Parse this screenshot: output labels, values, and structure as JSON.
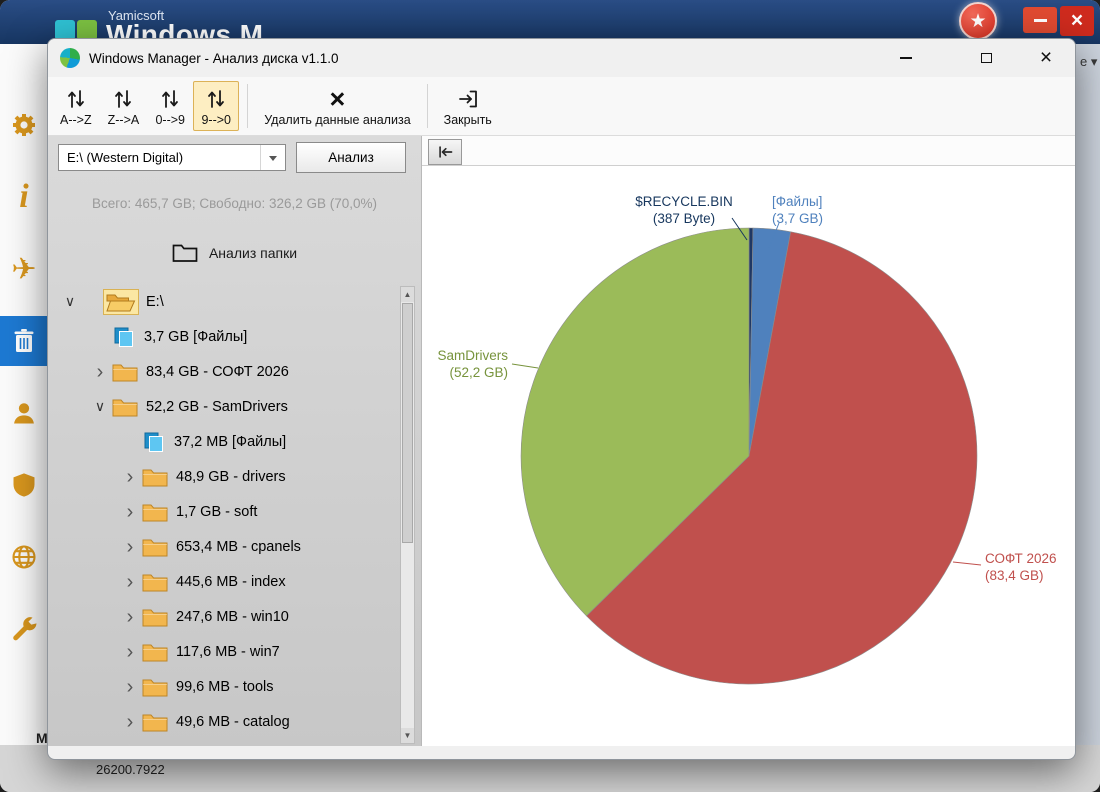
{
  "bg": {
    "brand": "Yamicsoft",
    "app_title": "Windows M",
    "edge_text": "e ▾",
    "fragment": "M",
    "build": "26200.7922",
    "sidebar_icons": [
      {
        "name": "gear",
        "selected": false
      },
      {
        "name": "info",
        "selected": false
      },
      {
        "name": "airplane",
        "selected": false
      },
      {
        "name": "trash",
        "selected": true
      },
      {
        "name": "user",
        "selected": false
      },
      {
        "name": "shield",
        "selected": false
      },
      {
        "name": "globe",
        "selected": false
      },
      {
        "name": "wrench",
        "selected": false
      }
    ]
  },
  "dialog": {
    "title": "Windows Manager - Анализ диска v1.1.0",
    "toolbar": {
      "sort_buttons": [
        {
          "id": "az",
          "label": "A-->Z",
          "selected": false
        },
        {
          "id": "za",
          "label": "Z-->A",
          "selected": false
        },
        {
          "id": "09",
          "label": "0-->9",
          "selected": false
        },
        {
          "id": "90",
          "label": "9-->0",
          "selected": true
        }
      ],
      "delete_label": "Удалить данные анализа",
      "close_label": "Закрыть"
    },
    "drive_combo": {
      "value": "E:\\ (Western Digital)"
    },
    "analyze_button": "Анализ",
    "summary": "Всего: 465,7 GB; Свободно: 326,2 GB (70,0%)",
    "folder_analyze_label": "Анализ папки",
    "tree": [
      {
        "label": "E:\\",
        "level": 0,
        "icon": "folder-open",
        "state": "expanded",
        "selected": true
      },
      {
        "label": "3,7 GB [Файлы]",
        "level": 1,
        "icon": "files",
        "state": "none",
        "selected": false
      },
      {
        "label": "83,4 GB - СОФТ 2026",
        "level": 1,
        "icon": "folder",
        "state": "collapsed",
        "selected": false
      },
      {
        "label": "52,2 GB - SamDrivers",
        "level": 1,
        "icon": "folder",
        "state": "expanded",
        "selected": false
      },
      {
        "label": "37,2 MB [Файлы]",
        "level": 2,
        "icon": "files",
        "state": "none",
        "selected": false
      },
      {
        "label": "48,9 GB - drivers",
        "level": 2,
        "icon": "folder",
        "state": "collapsed",
        "selected": false
      },
      {
        "label": "1,7 GB - soft",
        "level": 2,
        "icon": "folder",
        "state": "collapsed",
        "selected": false
      },
      {
        "label": "653,4 MB - cpanels",
        "level": 2,
        "icon": "folder",
        "state": "collapsed",
        "selected": false
      },
      {
        "label": "445,6 MB - index",
        "level": 2,
        "icon": "folder",
        "state": "collapsed",
        "selected": false
      },
      {
        "label": "247,6 MB - win10",
        "level": 2,
        "icon": "folder",
        "state": "collapsed",
        "selected": false
      },
      {
        "label": "117,6 MB - win7",
        "level": 2,
        "icon": "folder",
        "state": "collapsed",
        "selected": false
      },
      {
        "label": "99,6 MB - tools",
        "level": 2,
        "icon": "folder",
        "state": "collapsed",
        "selected": false
      },
      {
        "label": "49,6 MB - catalog",
        "level": 2,
        "icon": "folder",
        "state": "collapsed",
        "selected": false
      },
      {
        "label": "",
        "level": 2,
        "icon": "folder",
        "state": "collapsed",
        "selected": false
      }
    ]
  },
  "chart_data": {
    "type": "pie",
    "title": "",
    "legend": "callout-labels",
    "center": [
      327,
      290
    ],
    "radius": 228,
    "start_angle_deg": 0,
    "clockwise": true,
    "slices": [
      {
        "label": "$RECYCLE.BIN",
        "sublabel": "(387 Byte)",
        "value_gb": 3.6e-07,
        "color": "#1f3864",
        "label_color": "#17375e",
        "anchor": "middle",
        "text": [
          262,
          40
        ],
        "line": [
          [
            310,
            52
          ],
          [
            325,
            74
          ]
        ]
      },
      {
        "label": "[Файлы]",
        "sublabel": "(3,7 GB)",
        "value_gb": 3.7,
        "color": "#4f81bd",
        "label_color": "#4f81bd",
        "anchor": "start",
        "text": [
          350,
          40
        ],
        "line": [
          [
            357,
            57
          ],
          [
            347,
            82
          ]
        ]
      },
      {
        "label": "СОФТ 2026",
        "sublabel": "(83,4 GB)",
        "value_gb": 83.4,
        "color": "#c0504d",
        "label_color": "#c0504d",
        "anchor": "start",
        "text": [
          563,
          397
        ],
        "line": [
          [
            559,
            399
          ],
          [
            531,
            396
          ]
        ]
      },
      {
        "label": "SamDrivers",
        "sublabel": "(52,2 GB)",
        "value_gb": 52.2,
        "color": "#9bbb59",
        "label_color": "#77933c",
        "anchor": "end",
        "text": [
          86,
          194
        ],
        "line": [
          [
            90,
            198
          ],
          [
            116,
            202
          ]
        ]
      }
    ]
  }
}
